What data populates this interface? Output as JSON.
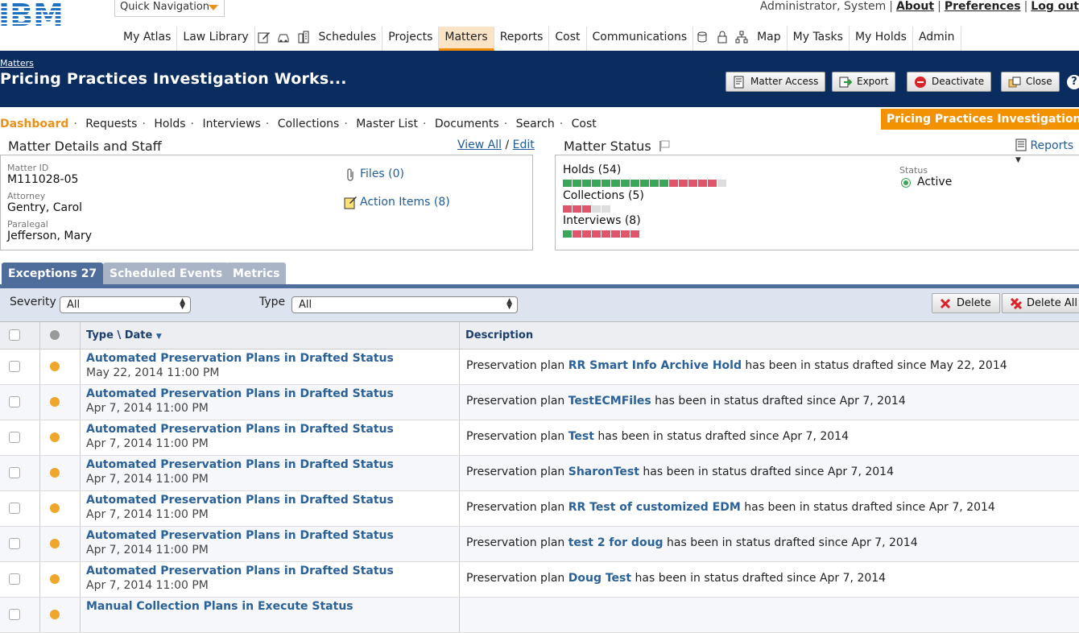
{
  "top": {
    "brand": "IBM",
    "quick_nav": "Quick Navigation",
    "user": "Administrator, System",
    "links": [
      "About",
      "Preferences",
      "Log out"
    ]
  },
  "nav": {
    "items": [
      "My Atlas",
      "Law Library",
      "Schedules",
      "Projects",
      "Matters",
      "Reports",
      "Cost",
      "Communications",
      "Map",
      "My Tasks",
      "My Holds",
      "Admin"
    ],
    "active": "Matters"
  },
  "header": {
    "breadcrumb": "Matters",
    "title": "Pricing Practices Investigation Works...",
    "buttons": {
      "access": "Matter Access",
      "export": "Export",
      "deactivate": "Deactivate",
      "close": "Close"
    },
    "help": "?"
  },
  "subnav": {
    "items": [
      "Dashboard",
      "Requests",
      "Holds",
      "Interviews",
      "Collections",
      "Master List",
      "Documents",
      "Search",
      "Cost"
    ],
    "badge": "Pricing Practices Investigation"
  },
  "details": {
    "title": "Matter Details and Staff",
    "view_all": "View All",
    "edit": "Edit",
    "sep": "/",
    "matter_id_label": "Matter ID",
    "matter_id": "M111028-05",
    "attorney_label": "Attorney",
    "attorney": "Gentry, Carol",
    "paralegal_label": "Paralegal",
    "paralegal": "Jefferson, Mary",
    "files": "Files (0)",
    "action_items": "Action Items (8)"
  },
  "status": {
    "title": "Matter Status",
    "reports": "Reports",
    "holds": "Holds (54)",
    "collections": "Collections (5)",
    "interviews": "Interviews (8)",
    "status_label": "Status",
    "status_value": "Active",
    "holds_bar": {
      "green": 11,
      "red": 5,
      "empty": 1
    },
    "collections_bar": {
      "green": 0,
      "red": 3,
      "empty": 2
    },
    "interviews_bar": {
      "green": 1,
      "red": 7,
      "empty": 0
    }
  },
  "tabs": [
    "Exceptions 27",
    "Scheduled Events",
    "Metrics"
  ],
  "filters": {
    "severity_label": "Severity",
    "severity_value": "All",
    "type_label": "Type",
    "type_value": "All",
    "delete": "Delete",
    "delete_all": "Delete All"
  },
  "table": {
    "col_type": "Type \\ Date",
    "col_desc": "Description",
    "rows": [
      {
        "type": "Automated Preservation Plans in Drafted Status",
        "date": "May 22, 2014 11:00 PM",
        "pre": "Preservation plan ",
        "name": "RR Smart Info Archive Hold",
        "post": " has been in status drafted since May 22, 2014"
      },
      {
        "type": "Automated Preservation Plans in Drafted Status",
        "date": "Apr 7, 2014 11:00 PM",
        "pre": "Preservation plan ",
        "name": "TestECMFiles",
        "post": " has been in status drafted since Apr 7, 2014"
      },
      {
        "type": "Automated Preservation Plans in Drafted Status",
        "date": "Apr 7, 2014 11:00 PM",
        "pre": "Preservation plan ",
        "name": "Test",
        "post": " has been in status drafted since Apr 7, 2014"
      },
      {
        "type": "Automated Preservation Plans in Drafted Status",
        "date": "Apr 7, 2014 11:00 PM",
        "pre": "Preservation plan ",
        "name": "SharonTest",
        "post": " has been in status drafted since Apr 7, 2014"
      },
      {
        "type": "Automated Preservation Plans in Drafted Status",
        "date": "Apr 7, 2014 11:00 PM",
        "pre": "Preservation plan ",
        "name": "RR Test of customized EDM",
        "post": " has been in status drafted since Apr 7, 2014"
      },
      {
        "type": "Automated Preservation Plans in Drafted Status",
        "date": "Apr 7, 2014 11:00 PM",
        "pre": "Preservation plan ",
        "name": "test 2 for doug",
        "post": " has been in status drafted since Apr 7, 2014"
      },
      {
        "type": "Automated Preservation Plans in Drafted Status",
        "date": "Apr 7, 2014 11:00 PM",
        "pre": "Preservation plan ",
        "name": "Doug Test",
        "post": " has been in status drafted since Apr 7, 2014"
      },
      {
        "type": "Manual Collection Plans in Execute Status",
        "date": "",
        "pre": "",
        "name": "",
        "post": ""
      }
    ]
  },
  "colors": {
    "header_blue": "#0b2c5e",
    "accent_orange": "#f39200",
    "link_blue": "#2a6199",
    "bar_green": "#3aa65a",
    "bar_red": "#e0556a"
  }
}
